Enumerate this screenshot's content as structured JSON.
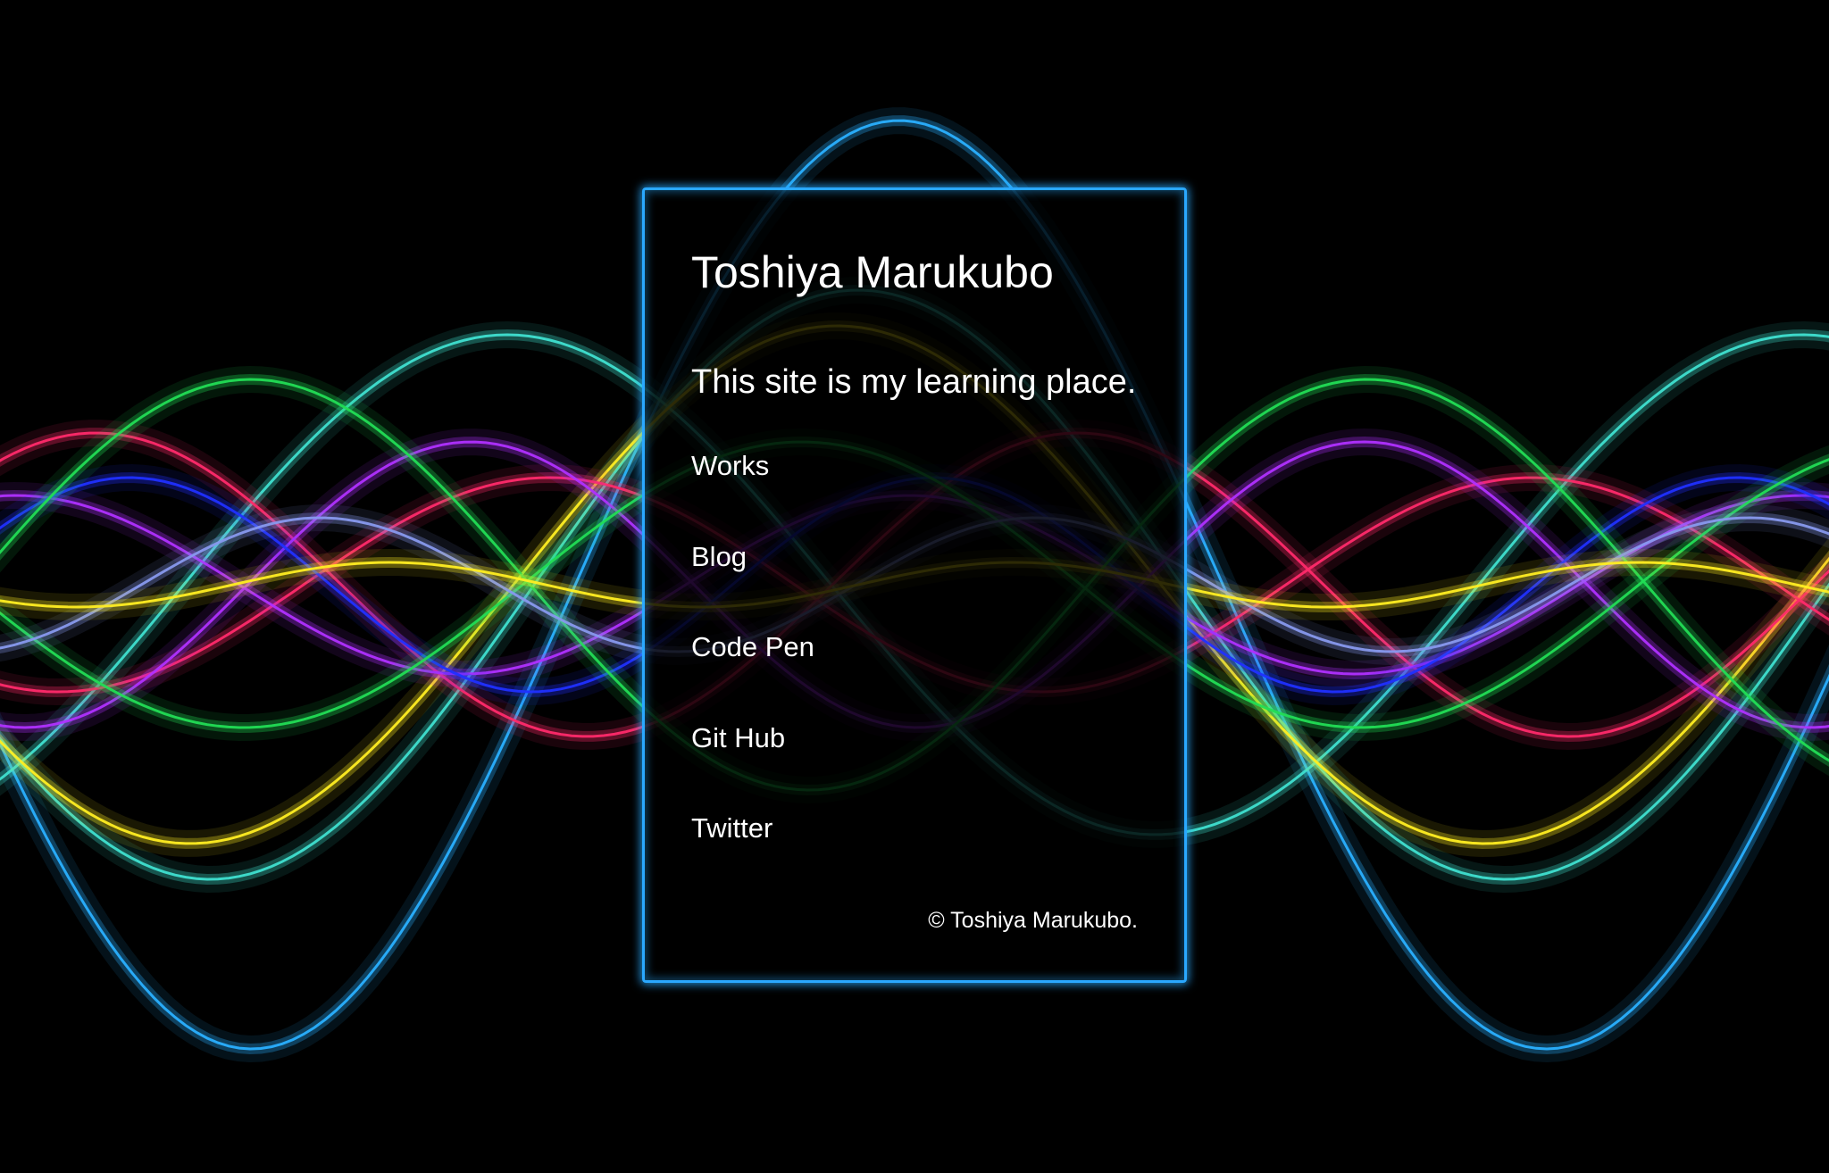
{
  "site": {
    "title": "Toshiya Marukubo",
    "tagline": "This site is my learning place.",
    "copyright": "© Toshiya Marukubo."
  },
  "nav": {
    "items": [
      {
        "label": "Works"
      },
      {
        "label": "Blog"
      },
      {
        "label": "Code Pen"
      },
      {
        "label": "Git Hub"
      },
      {
        "label": "Twitter"
      }
    ]
  },
  "theme": {
    "background": "#000000",
    "accent": "#2aa8ff",
    "wave_colors": [
      "#2ab0ff",
      "#3fe0d0",
      "#ffee22",
      "#ff2a6a",
      "#b030ff",
      "#2030ff",
      "#22dd55",
      "#8899ee"
    ]
  }
}
